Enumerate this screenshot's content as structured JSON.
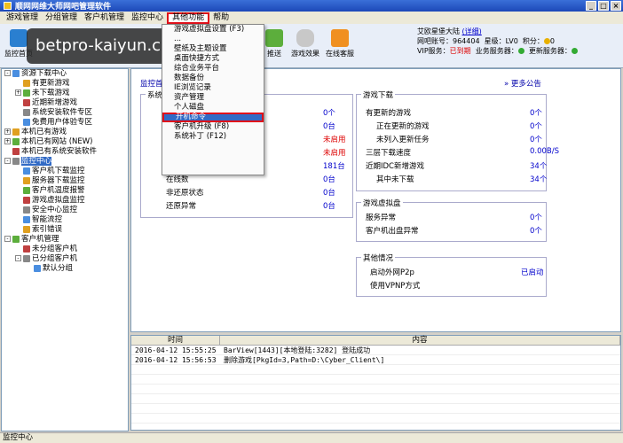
{
  "window": {
    "title": "顺网网维大师网吧管理软件"
  },
  "menu": [
    "游戏管理",
    "分组管理",
    "客户机管理",
    "监控中心",
    "其他功能",
    "帮助"
  ],
  "toolbar": {
    "buttons": [
      "监控首页",
      "推送",
      "游戏效果",
      "在线客服"
    ],
    "watermark": "betpro-kaiyun.com.cn"
  },
  "info": {
    "user": "艾欧星堡大陆",
    "detail_link": "(详细)",
    "netbar_label": "网吧账号：",
    "netbar_id": "964404",
    "level_label": "星级：",
    "level": "LV0",
    "points_label": "积分：",
    "points": "0",
    "vip_label": "VIP服务：",
    "vip_status": "已到期",
    "biz_server_label": "业务服务器：",
    "update_server_label": "更新服务器："
  },
  "tree": [
    {
      "label": "资源下载中心",
      "level": 0,
      "expand": "-"
    },
    {
      "label": "有更新游戏",
      "level": 1
    },
    {
      "label": "未下载游戏",
      "level": 1,
      "expand": "+"
    },
    {
      "label": "近期新增游戏",
      "level": 1
    },
    {
      "label": "系统安装软件专区",
      "level": 1
    },
    {
      "label": "免费用户体验专区",
      "level": 1
    },
    {
      "label": "本机已有游戏",
      "level": 0,
      "expand": "+"
    },
    {
      "label": "本机已有网站 (NEW)",
      "level": 0,
      "expand": "+"
    },
    {
      "label": "本机已有系统安装软件",
      "level": 0
    },
    {
      "label": "监控中心",
      "level": 0,
      "expand": "-",
      "selected": true
    },
    {
      "label": "客户机下载监控",
      "level": 1
    },
    {
      "label": "服务器下载监控",
      "level": 1
    },
    {
      "label": "客户机温度报警",
      "level": 1
    },
    {
      "label": "游戏虚拟盘监控",
      "level": 1
    },
    {
      "label": "安全中心监控",
      "level": 1
    },
    {
      "label": "智能流控",
      "level": 1
    },
    {
      "label": "索引错误",
      "level": 1
    },
    {
      "label": "客户机管理",
      "level": 0,
      "expand": "-"
    },
    {
      "label": "未分组客户机",
      "level": 1
    },
    {
      "label": "已分组客户机",
      "level": 1,
      "expand": "-"
    },
    {
      "label": "默认分组",
      "level": 2
    }
  ],
  "dropdown": [
    "游戏虚拟盘设置 (F3)",
    "...",
    "壁纸及主题设置",
    "桌面快捷方式",
    "综合业务平台",
    "数据备份",
    "IE浏览记录",
    "资产管理",
    "个人磁盘",
    "开机命令",
    "客户机升级 (F8)",
    "系统补丁 (F12)"
  ],
  "main": {
    "header": "监控首页",
    "more_notice": "更多公告",
    "system": {
      "title": "系统",
      "rows": [
        {
          "label": "",
          "value": "0个",
          "color": "blue"
        },
        {
          "label": "",
          "value": "0台",
          "color": "blue"
        },
        {
          "label": "",
          "value": "未启用",
          "color": "red"
        },
        {
          "label": "",
          "value": "未启用",
          "color": "red"
        },
        {
          "label": "",
          "value": "181台",
          "color": "blue"
        },
        {
          "label": "在线数",
          "value": "0台",
          "color": "blue"
        },
        {
          "label": "非还原状态",
          "value": "0台",
          "color": "blue"
        },
        {
          "label": "还原异常",
          "value": "0台",
          "color": "blue"
        }
      ]
    },
    "game_download": {
      "title": "游戏下载",
      "rows": [
        {
          "label": "有更新的游戏",
          "value": "0个",
          "indent": 0
        },
        {
          "label": "正在更新的游戏",
          "value": "0个",
          "indent": 1
        },
        {
          "label": "未列入更新任务",
          "value": "0个",
          "indent": 1
        },
        {
          "label": "三层下载速度",
          "value": "0.00B/S",
          "indent": 0
        },
        {
          "label": "近期IDC新增游戏",
          "value": "34个",
          "indent": 0
        },
        {
          "label": "其中未下载",
          "value": "34个",
          "indent": 1
        }
      ]
    },
    "vdisk": {
      "title": "游戏虚拟盘",
      "rows": [
        {
          "label": "服务异常",
          "value": "0个"
        },
        {
          "label": "客户机出盘异常",
          "value": "0个"
        }
      ]
    },
    "other": {
      "title": "其他情况",
      "rows": [
        {
          "label": "启动外网P2p",
          "value": "已启动"
        },
        {
          "label": "使用VPNP方式",
          "value": ""
        }
      ]
    }
  },
  "log": {
    "headers": [
      "时间",
      "内容"
    ],
    "rows": [
      {
        "time": "2016-04-12 15:55:25",
        "content": "BarView[1443][本地登陆:3282] 登陆成功"
      },
      {
        "time": "2016-04-12 15:56:53",
        "content": "删除游戏[PkgId=3,Path=D:\\Cyber_Client\\]"
      }
    ]
  },
  "status": "监控中心",
  "colors": {
    "accent": "#316ac5",
    "highlight_border": "#e0101a",
    "link": "#0000cc",
    "alert": "#dd0000"
  }
}
